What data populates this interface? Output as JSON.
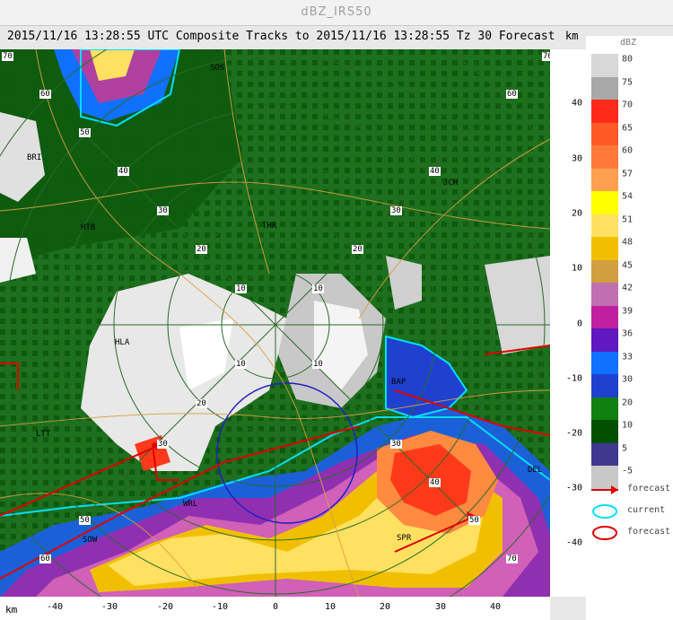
{
  "window": {
    "title": "dBZ_IRS50"
  },
  "header": {
    "text": "2015/11/16 13:28:55 UTC Composite Tracks to 2015/11/16 13:28:55 Tz 30 Forecast"
  },
  "axes": {
    "unit": "km",
    "x_ticks": [
      "-40",
      "-30",
      "-20",
      "-10",
      "0",
      "10",
      "20",
      "30",
      "40"
    ],
    "y_ticks": [
      "40",
      "30",
      "20",
      "10",
      "0",
      "-10",
      "-20",
      "-30",
      "-40"
    ]
  },
  "map": {
    "range_labels": [
      "10",
      "10",
      "10",
      "10",
      "20",
      "20",
      "20",
      "30",
      "30",
      "30",
      "30",
      "40",
      "40",
      "40",
      "50",
      "50",
      "50",
      "60",
      "60",
      "60",
      "70",
      "70",
      "70"
    ],
    "stations": [
      "SOS",
      "BRI",
      "HTB",
      "HLA",
      "LTT",
      "BAP",
      "SPR",
      "SOW",
      "DEL",
      "WRL",
      "JCH",
      "THR"
    ],
    "colors": {
      "cell_core": "#ff3a1a",
      "cell_orange": "#ff8a40",
      "cell_yellow": "#ffe030",
      "cell_pink": "#e070c0",
      "current_track": "#00e0ff",
      "forecast_track": "#e00000"
    }
  },
  "legend": {
    "unit": "dBZ",
    "scale": [
      {
        "label": "80",
        "color": "#d8d8d8"
      },
      {
        "label": "75",
        "color": "#a8a8a8"
      },
      {
        "label": "70",
        "color": "#ff2a1a"
      },
      {
        "label": "65",
        "color": "#ff5a28"
      },
      {
        "label": "60",
        "color": "#ff7a3a"
      },
      {
        "label": "57",
        "color": "#ffa050"
      },
      {
        "label": "54",
        "color": "#ffff00"
      },
      {
        "label": "51",
        "color": "#ffe060"
      },
      {
        "label": "48",
        "color": "#f0c000"
      },
      {
        "label": "45",
        "color": "#d0a040"
      },
      {
        "label": "42",
        "color": "#c070b0"
      },
      {
        "label": "39",
        "color": "#c020a0"
      },
      {
        "label": "36",
        "color": "#6018c0"
      },
      {
        "label": "33",
        "color": "#1070ff"
      },
      {
        "label": "30",
        "color": "#2040d0"
      },
      {
        "label": "20",
        "color": "#108010"
      },
      {
        "label": "10",
        "color": "#005000"
      },
      {
        "label": "5",
        "color": "#403890"
      },
      {
        "label": "-5",
        "color": "#c8c8c8"
      }
    ],
    "items": [
      {
        "label": "forecast",
        "icon": "arrow-icon"
      },
      {
        "label": "current",
        "icon": "ellipse-icon"
      },
      {
        "label": "forecast",
        "icon": "ellipse-icon"
      }
    ]
  }
}
